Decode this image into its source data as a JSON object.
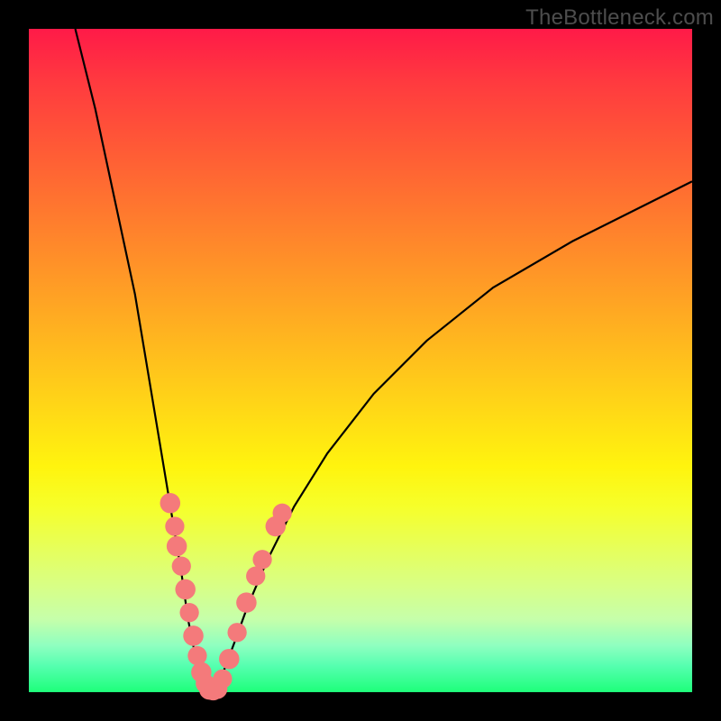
{
  "watermark": "TheBottleneck.com",
  "chart_data": {
    "type": "line",
    "title": "",
    "xlabel": "",
    "ylabel": "",
    "xlim": [
      0,
      100
    ],
    "ylim": [
      0,
      100
    ],
    "grid": false,
    "legend": false,
    "series": [
      {
        "name": "curve-left",
        "color": "#000000",
        "x": [
          7,
          10,
          13,
          16,
          18,
          20,
          21.5,
          23,
          24,
          25,
          25.8,
          26.5,
          27,
          27.4
        ],
        "y": [
          100,
          88,
          74,
          60,
          48,
          36,
          27,
          18,
          11,
          6,
          3,
          1.2,
          0.3,
          0
        ]
      },
      {
        "name": "curve-right",
        "color": "#000000",
        "x": [
          27.4,
          28.2,
          29.5,
          31,
          33,
          36,
          40,
          45,
          52,
          60,
          70,
          82,
          100
        ],
        "y": [
          0,
          1,
          3.5,
          7.5,
          13,
          20,
          28,
          36,
          45,
          53,
          61,
          68,
          77
        ]
      }
    ],
    "markers": [
      {
        "name": "marker",
        "color": "#f47a7b",
        "x": 21.3,
        "y": 28.5,
        "r": 1.8
      },
      {
        "name": "marker",
        "color": "#f47a7b",
        "x": 22.0,
        "y": 25.0,
        "r": 1.7
      },
      {
        "name": "marker",
        "color": "#f47a7b",
        "x": 22.3,
        "y": 22.0,
        "r": 1.8
      },
      {
        "name": "marker",
        "color": "#f47a7b",
        "x": 23.0,
        "y": 19.0,
        "r": 1.7
      },
      {
        "name": "marker",
        "color": "#f47a7b",
        "x": 23.6,
        "y": 15.5,
        "r": 1.8
      },
      {
        "name": "marker",
        "color": "#f47a7b",
        "x": 24.2,
        "y": 12.0,
        "r": 1.7
      },
      {
        "name": "marker",
        "color": "#f47a7b",
        "x": 24.8,
        "y": 8.5,
        "r": 1.8
      },
      {
        "name": "marker",
        "color": "#f47a7b",
        "x": 25.4,
        "y": 5.5,
        "r": 1.7
      },
      {
        "name": "marker",
        "color": "#f47a7b",
        "x": 26.0,
        "y": 3.0,
        "r": 1.8
      },
      {
        "name": "marker",
        "color": "#f47a7b",
        "x": 26.6,
        "y": 1.3,
        "r": 1.7
      },
      {
        "name": "marker",
        "color": "#f47a7b",
        "x": 27.2,
        "y": 0.4,
        "r": 1.8
      },
      {
        "name": "marker",
        "color": "#f47a7b",
        "x": 27.8,
        "y": 0.2,
        "r": 1.7
      },
      {
        "name": "marker",
        "color": "#f47a7b",
        "x": 28.4,
        "y": 0.5,
        "r": 1.8
      },
      {
        "name": "marker",
        "color": "#f47a7b",
        "x": 29.2,
        "y": 2.0,
        "r": 1.7
      },
      {
        "name": "marker",
        "color": "#f47a7b",
        "x": 30.2,
        "y": 5.0,
        "r": 1.8
      },
      {
        "name": "marker",
        "color": "#f47a7b",
        "x": 31.4,
        "y": 9.0,
        "r": 1.7
      },
      {
        "name": "marker",
        "color": "#f47a7b",
        "x": 32.8,
        "y": 13.5,
        "r": 1.8
      },
      {
        "name": "marker",
        "color": "#f47a7b",
        "x": 34.2,
        "y": 17.5,
        "r": 1.7
      },
      {
        "name": "marker",
        "color": "#f47a7b",
        "x": 35.2,
        "y": 20.0,
        "r": 1.7
      },
      {
        "name": "marker",
        "color": "#f47a7b",
        "x": 37.2,
        "y": 25.0,
        "r": 1.8
      },
      {
        "name": "marker",
        "color": "#f47a7b",
        "x": 38.2,
        "y": 27.0,
        "r": 1.7
      }
    ]
  }
}
